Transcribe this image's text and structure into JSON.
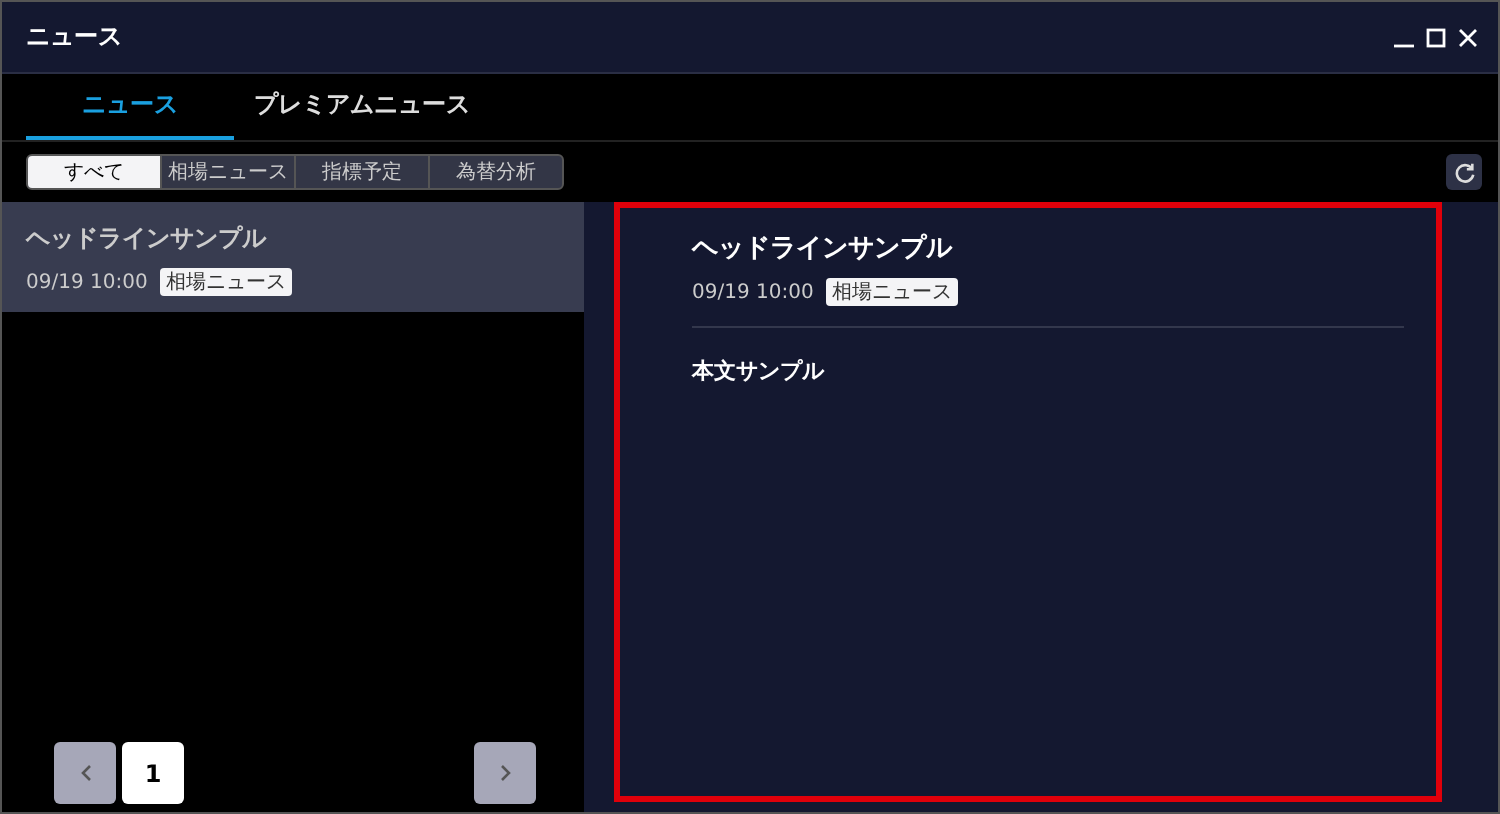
{
  "window": {
    "title": "ニュース"
  },
  "tabs": [
    {
      "label": "ニュース",
      "selected": true
    },
    {
      "label": "プレミアムニュース",
      "selected": false
    }
  ],
  "filters": [
    {
      "label": "すべて",
      "selected": true
    },
    {
      "label": "相場ニュース",
      "selected": false
    },
    {
      "label": "指標予定",
      "selected": false
    },
    {
      "label": "為替分析",
      "selected": false
    }
  ],
  "news_list": [
    {
      "headline": "ヘッドラインサンプル",
      "time": "09/19 10:00",
      "tag": "相場ニュース",
      "selected": true
    }
  ],
  "pagination": {
    "pages": [
      {
        "label": "1",
        "selected": true
      }
    ]
  },
  "article": {
    "headline": "ヘッドラインサンプル",
    "time": "09/19 10:00",
    "tag": "相場ニュース",
    "body": "本文サンプル",
    "highlighted": true
  }
}
